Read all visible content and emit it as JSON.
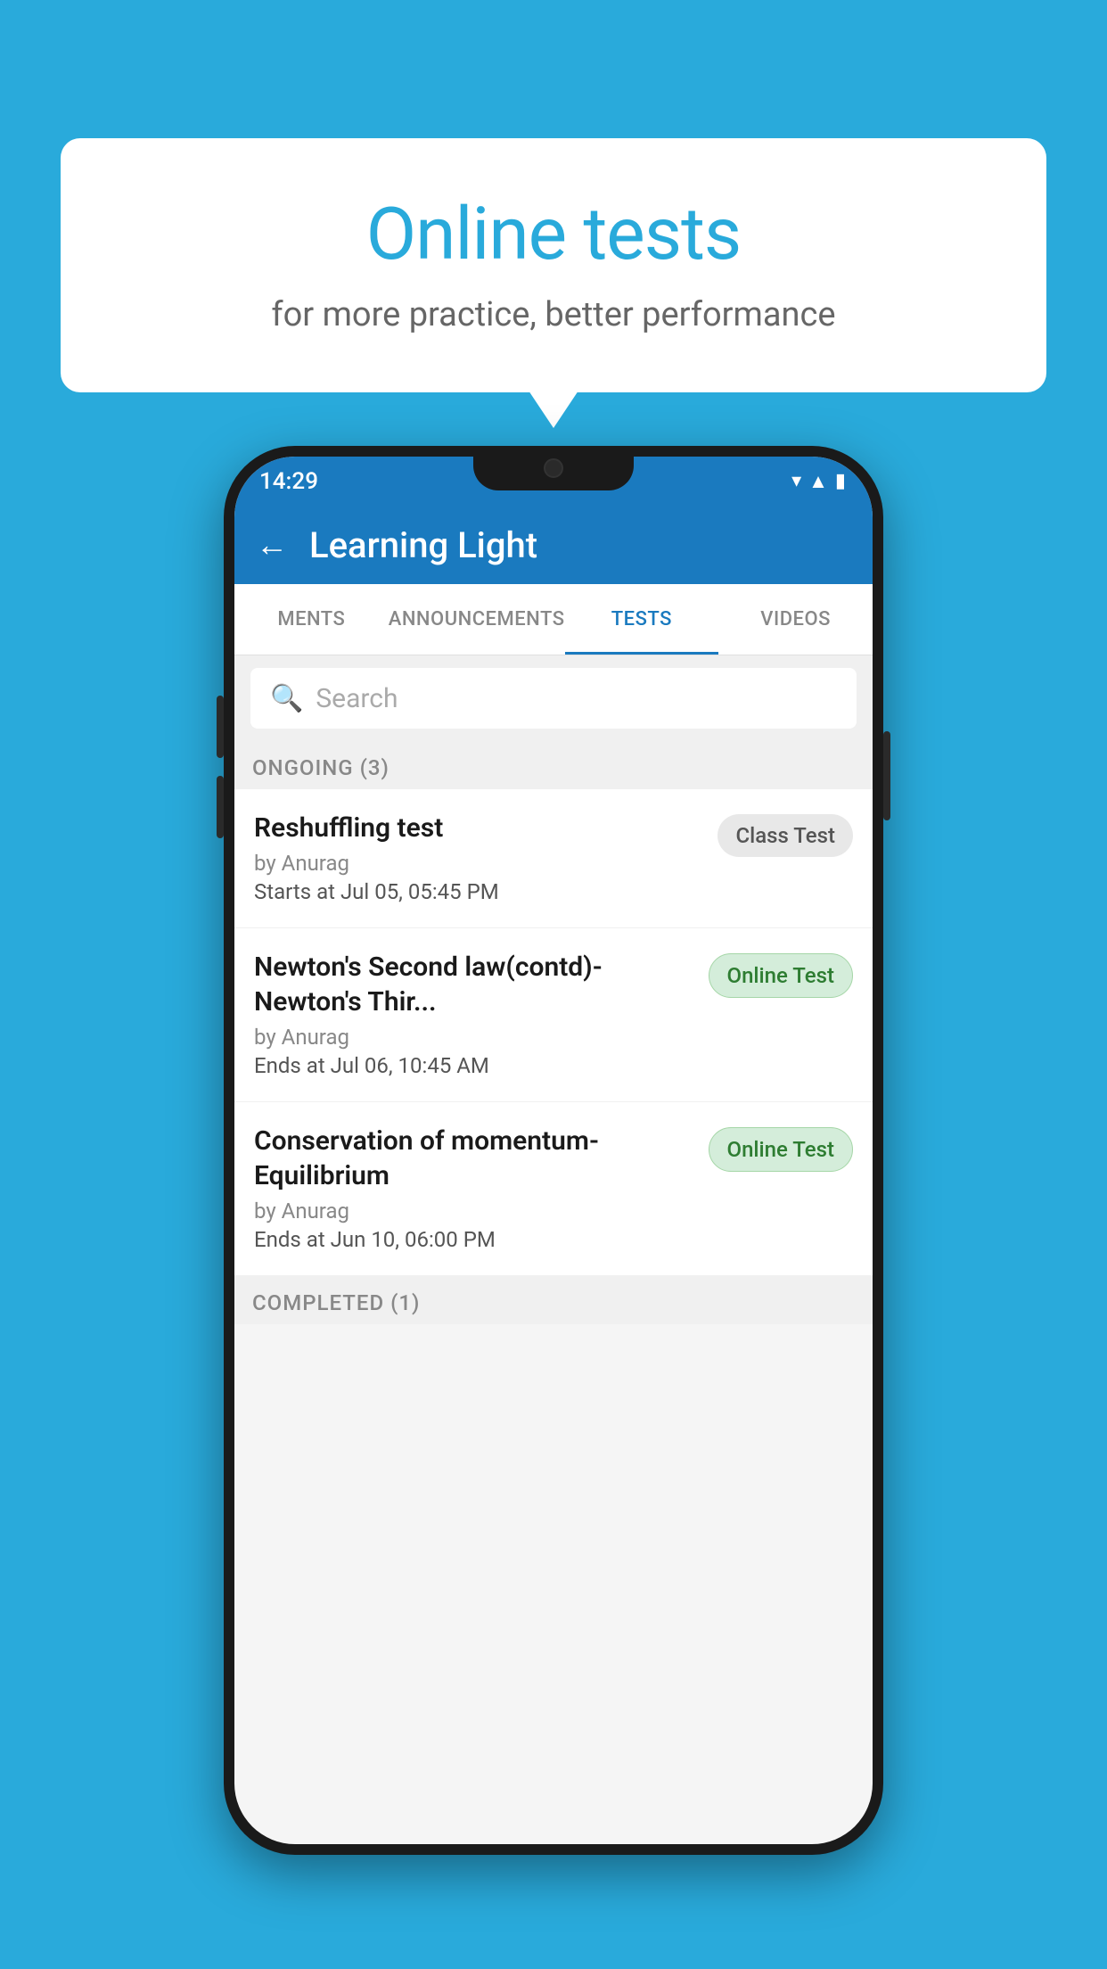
{
  "background": {
    "color": "#29AADB"
  },
  "speech_bubble": {
    "title": "Online tests",
    "subtitle": "for more practice, better performance"
  },
  "phone": {
    "status_bar": {
      "time": "14:29",
      "icons": [
        "wifi",
        "signal",
        "battery"
      ]
    },
    "header": {
      "title": "Learning Light",
      "back_label": "←"
    },
    "tabs": [
      {
        "label": "MENTS",
        "active": false
      },
      {
        "label": "ANNOUNCEMENTS",
        "active": false
      },
      {
        "label": "TESTS",
        "active": true
      },
      {
        "label": "VIDEOS",
        "active": false
      }
    ],
    "search": {
      "placeholder": "Search"
    },
    "ongoing_section": {
      "title": "ONGOING (3)",
      "tests": [
        {
          "title": "Reshuffling test",
          "author": "by Anurag",
          "time_label": "Starts at",
          "time_value": "Jul 05, 05:45 PM",
          "badge": "Class Test",
          "badge_type": "class"
        },
        {
          "title": "Newton's Second law(contd)-Newton's Thir...",
          "author": "by Anurag",
          "time_label": "Ends at",
          "time_value": "Jul 06, 10:45 AM",
          "badge": "Online Test",
          "badge_type": "online"
        },
        {
          "title": "Conservation of momentum-Equilibrium",
          "author": "by Anurag",
          "time_label": "Ends at",
          "time_value": "Jun 10, 06:00 PM",
          "badge": "Online Test",
          "badge_type": "online"
        }
      ]
    },
    "completed_section": {
      "title": "COMPLETED (1)"
    }
  }
}
